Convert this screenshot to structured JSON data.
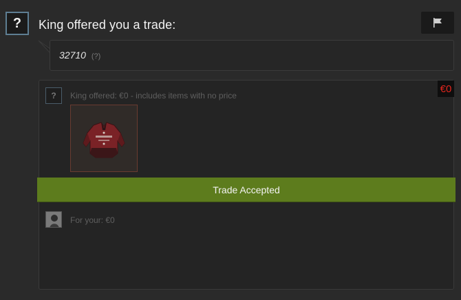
{
  "header": {
    "avatar_glyph": "?",
    "title": "King offered you a trade:",
    "report_icon": "flag-icon"
  },
  "message": {
    "text": "32710",
    "help": "(?)"
  },
  "offer": {
    "avatar_glyph": "?",
    "label": "King offered: €0 - includes items with no price",
    "price_badge": "€0",
    "item_icon": "red-jacket-item-icon"
  },
  "status": {
    "label": "Trade Accepted",
    "color": "#5d7c1d"
  },
  "your_side": {
    "label": "For your: €0"
  },
  "colors": {
    "background": "#2a2a2a",
    "price_red": "#e3261d",
    "avatar_border": "#5e7e93"
  }
}
